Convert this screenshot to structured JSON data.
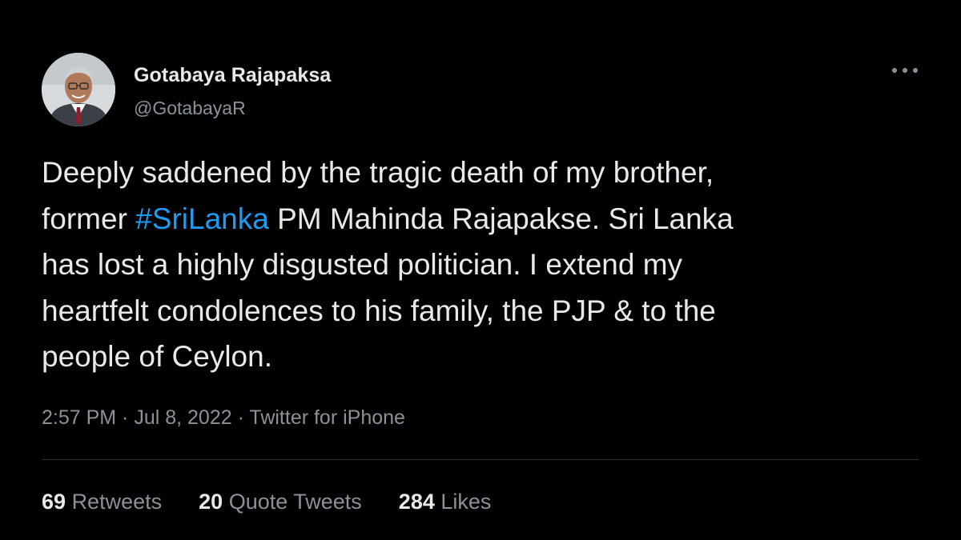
{
  "author": {
    "name": "Gotabaya Rajapaksa",
    "handle": "@GotabayaR",
    "avatar_icon": "profile-photo"
  },
  "more_icon": "more-options-icon",
  "tweet": {
    "lines": [
      {
        "text": "Deeply saddened by the tragic death of my brother,"
      },
      {
        "before": "former ",
        "hashtag": "#SriLanka",
        "after": " PM Mahinda Rajapakse. Sri Lanka"
      },
      {
        "text": "has lost a highly disgusted politician. I extend my"
      },
      {
        "text": "heartfelt condolences to his family, the PJP & to the"
      },
      {
        "text": "people of Ceylon."
      }
    ]
  },
  "meta": {
    "time": "2:57 PM",
    "sep1": " · ",
    "date": "Jul 8, 2022",
    "sep2": " · ",
    "source": "Twitter for iPhone"
  },
  "stats": {
    "retweets": {
      "count": "69",
      "label": "Retweets"
    },
    "quotes": {
      "count": "20",
      "label": "Quote Tweets"
    },
    "likes": {
      "count": "284",
      "label": "Likes"
    }
  },
  "colors": {
    "background": "#000000",
    "text": "#e7e9ea",
    "secondary": "#8b9198",
    "link": "#1d9bf0",
    "divider": "#2f3336"
  }
}
